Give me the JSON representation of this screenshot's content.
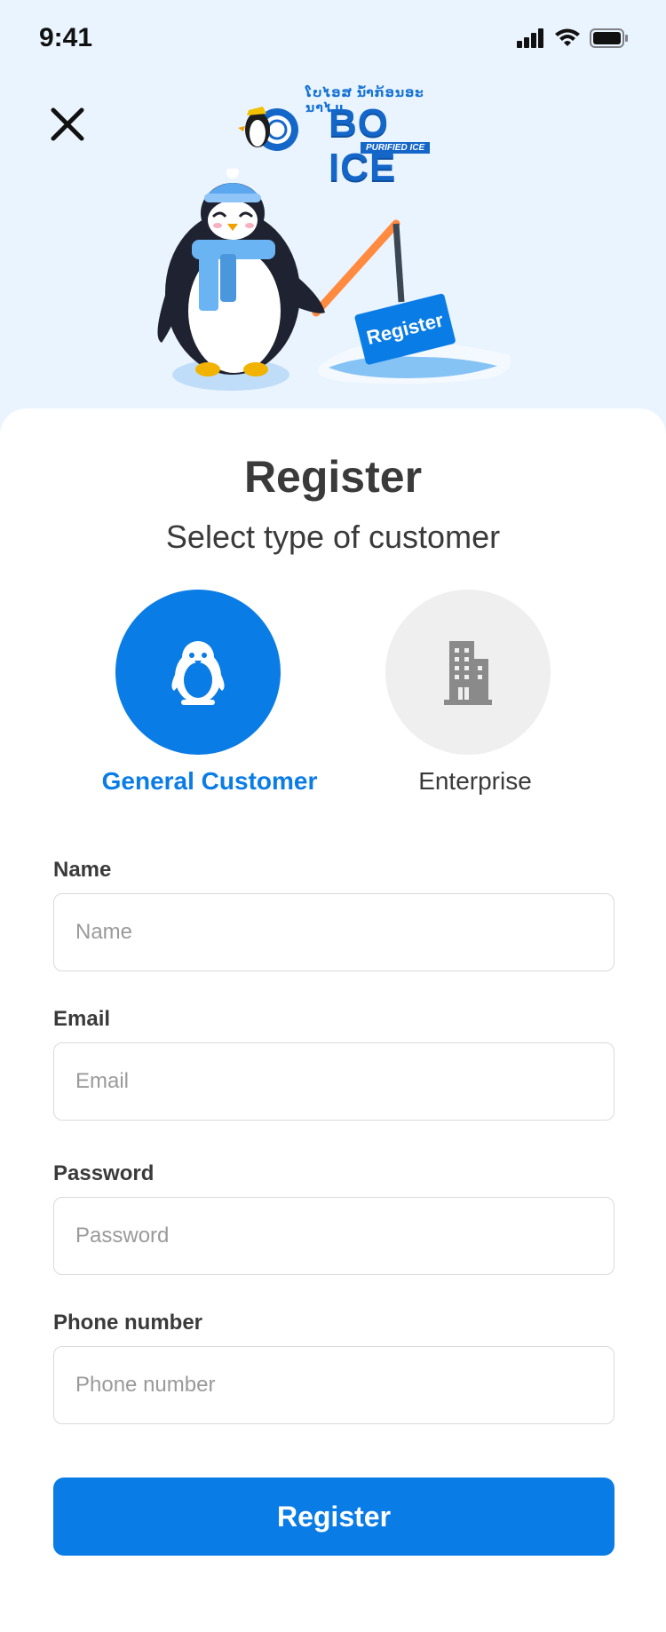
{
  "status_bar": {
    "time": "9:41"
  },
  "logo": {
    "top_text": "ໂບໄອສ ນ້ຳກ້ອນອະນາໄມ",
    "main_text": "BO ICE",
    "sub_text": "PURIFIED ICE"
  },
  "hero": {
    "sign_label": "Register"
  },
  "page": {
    "title": "Register",
    "subtitle": "Select type of customer"
  },
  "customer_types": [
    {
      "label": "General Customer",
      "icon": "penguin-icon",
      "selected": true
    },
    {
      "label": "Enterprise",
      "icon": "building-icon",
      "selected": false
    }
  ],
  "form": {
    "name": {
      "label": "Name",
      "placeholder": "Name",
      "value": ""
    },
    "email": {
      "label": "Email",
      "placeholder": "Email",
      "value": ""
    },
    "password": {
      "label": "Password",
      "placeholder": "Password",
      "value": ""
    },
    "phone": {
      "label": "Phone number",
      "placeholder": "Phone number",
      "value": ""
    }
  },
  "submit_label": "Register",
  "colors": {
    "accent": "#0A7CE6",
    "background": "#EAF4FF",
    "text": "#3A3A3A"
  }
}
